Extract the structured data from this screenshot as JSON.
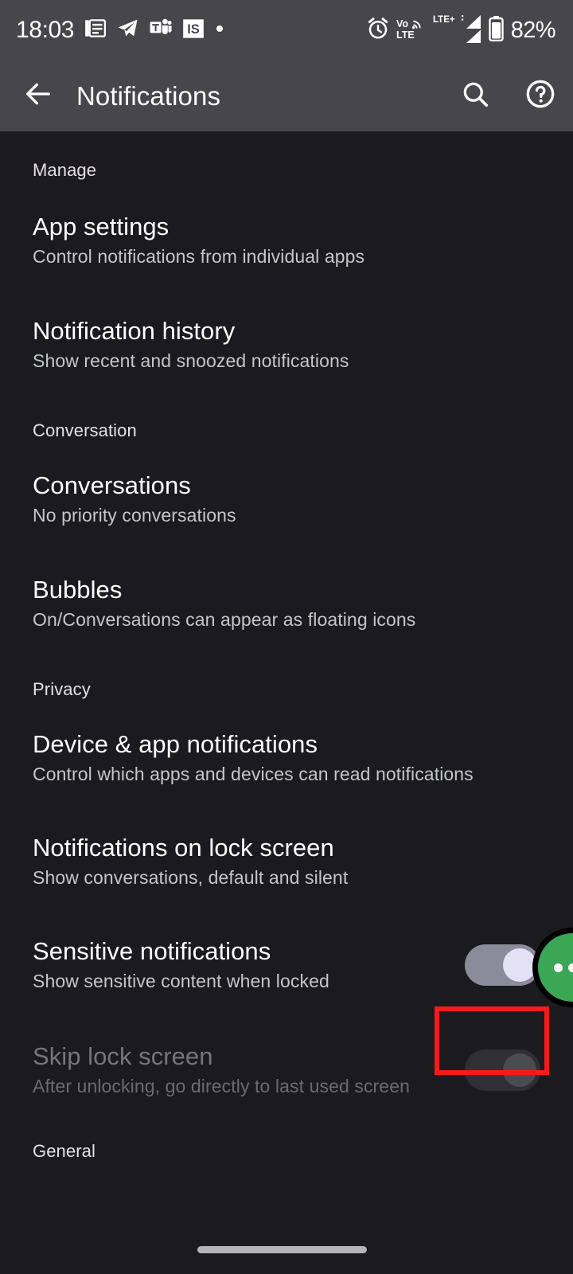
{
  "status_bar": {
    "time": "18:03",
    "battery_percent": "82%",
    "notification_icons": [
      "news-document-icon",
      "telegram-icon",
      "microsoft-teams-icon",
      "is-app-icon",
      "more-notifications-dot-icon"
    ],
    "system_icons": [
      "alarm-icon",
      "volte-icon",
      "lte-plus-icon",
      "signal-bars-sim1-icon",
      "signal-bars-sim2-icon",
      "battery-icon"
    ],
    "volte_label_top": "Vo",
    "volte_label_bottom": "LTE",
    "network_label": "LTE+"
  },
  "app_bar": {
    "title": "Notifications",
    "back_icon": "back-arrow-icon",
    "search_icon": "search-icon",
    "help_icon": "help-icon"
  },
  "sections": [
    {
      "header": "Manage",
      "items": [
        {
          "title": "App settings",
          "subtitle": "Control notifications from individual apps",
          "control": "none"
        },
        {
          "title": "Notification history",
          "subtitle": "Show recent and snoozed notifications",
          "control": "none"
        }
      ]
    },
    {
      "header": "Conversation",
      "items": [
        {
          "title": "Conversations",
          "subtitle": "No priority conversations",
          "control": "none"
        },
        {
          "title": "Bubbles",
          "subtitle": "On/Conversations can appear as floating icons",
          "control": "none"
        }
      ]
    },
    {
      "header": "Privacy",
      "items": [
        {
          "title": "Device & app notifications",
          "subtitle": "Control which apps and devices can read notifications",
          "control": "none"
        },
        {
          "title": "Notifications on lock screen",
          "subtitle": "Show conversations, default and silent",
          "control": "none"
        },
        {
          "title": "Sensitive notifications",
          "subtitle": "Show sensitive content when locked",
          "control": "switch",
          "switch_state": "on",
          "enabled": true,
          "highlighted": true
        },
        {
          "title": "Skip lock screen",
          "subtitle": "After unlocking, go directly to last used screen",
          "control": "switch",
          "switch_state": "off",
          "enabled": false,
          "highlighted": false
        }
      ]
    },
    {
      "header": "General",
      "items": []
    }
  ],
  "overlay": {
    "highlight_color": "#f61a1a",
    "bubble_icon": "chat-bubble-floating-icon",
    "bubble_color": "#3ba755"
  },
  "nav": {
    "gesture_pill": "home-gesture-pill"
  },
  "colors": {
    "status_bar_bg": "#46464b",
    "content_bg": "#1b1b1f",
    "switch_on_track": "#8b8b9a",
    "switch_on_thumb": "#e4e0f6",
    "switch_off_track": "#2f2f35",
    "switch_off_thumb": "#4b4b52"
  }
}
